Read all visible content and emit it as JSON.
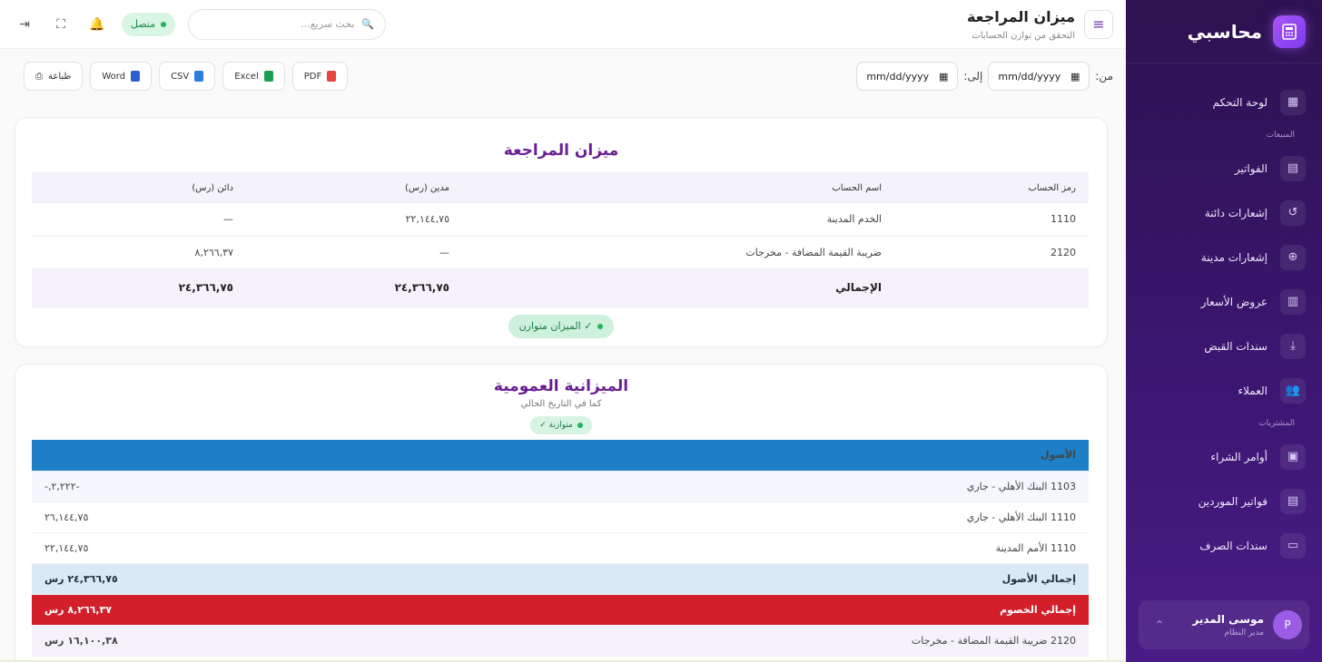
{
  "sidebar": {
    "brand": "محاسبي",
    "items": [
      {
        "label": "لوحة التحكم",
        "icon": "grid-icon"
      },
      {
        "section": "المبيعات"
      },
      {
        "label": "الفواتير",
        "icon": "document-icon"
      },
      {
        "label": "إشعارات دائنة",
        "icon": "undo-icon"
      },
      {
        "label": "إشعارات مدينة",
        "icon": "plus-circle-icon"
      },
      {
        "label": "عروض الأسعار",
        "icon": "file-icon"
      },
      {
        "label": "سندات القبض",
        "icon": "receive-icon"
      },
      {
        "label": "العملاء",
        "icon": "users-icon"
      },
      {
        "section": "المشتريات"
      },
      {
        "label": "أوامر الشراء",
        "icon": "clipboard-icon"
      },
      {
        "label": "فواتير الموردين",
        "icon": "document-icon"
      },
      {
        "label": "سندات الصرف",
        "icon": "money-icon"
      }
    ],
    "user": {
      "name": "موسى المدير",
      "role": "مدير النظام",
      "initial": "P"
    }
  },
  "header": {
    "title": "ميزان المراجعة",
    "subtitle": "التحقق من توازن الحسابات",
    "search_placeholder": "بحث سريع...",
    "status": "متصل"
  },
  "filters": {
    "from_label": "من:",
    "to_label": "إلى:",
    "from_value": "mm/dd/yyyy",
    "to_value": "mm/dd/yyyy"
  },
  "exports": {
    "pdf": "PDF",
    "excel": "Excel",
    "csv": "CSV",
    "word": "Word",
    "print": "طباعة"
  },
  "trial_balance": {
    "title": "ميزان المراجعة",
    "columns": [
      "رمز الحساب",
      "اسم الحساب",
      "مدين (رس)",
      "دائن (رس)"
    ],
    "rows": [
      {
        "code": "1110",
        "name": "الخدم المدينة",
        "debit": "٢٢,١٤٤,٧٥",
        "credit": "—"
      },
      {
        "code": "2120",
        "name": "ضريبة القيمة المضافة - مخرجات",
        "debit": "—",
        "credit": "٨,٢٦٦,٣٧"
      }
    ],
    "total_label": "الإجمالي",
    "total_debit": "٢٤,٣٦٦,٧٥",
    "total_credit": "٢٤,٣٦٦,٧٥",
    "balanced_label": "✓ الميزان متوازن"
  },
  "balance_sheet": {
    "title": "الميزانية العمومية",
    "subtitle": "كما في التاريخ الحالي",
    "badge": "متوازنة ✓",
    "assets_header": "الأصول",
    "assets": [
      {
        "name": "1103 البنك الأهلي - جاري",
        "amount": "-٢,٢٢٢,-"
      },
      {
        "name": "1110 البنك الأهلي - جاري",
        "amount": "٢٦,١٤٤,٧٥"
      },
      {
        "name": "1110 الأمم المدينة",
        "amount": "٢٢,١٤٤,٧٥"
      }
    ],
    "assets_total_label": "إجمالي الأصول",
    "assets_total": "٢٤,٣٦٦,٧٥ رس",
    "liabilities_label": "إجمالي الخصوم",
    "liabilities_total": "٨,٢٦٦,٣٧ رس",
    "liability_rows": [
      {
        "name": "2120 ضريبة القيمة المضافة - مخرجات",
        "amount": "١٦,١٠٠,٣٨ رس"
      }
    ]
  }
}
